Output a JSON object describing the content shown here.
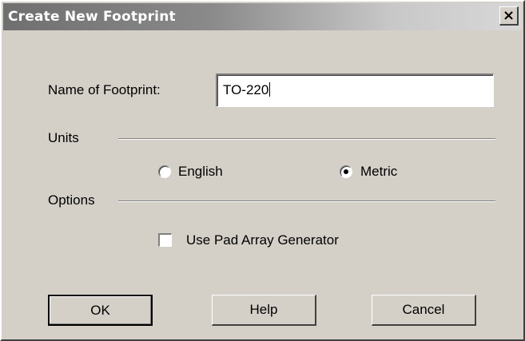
{
  "window": {
    "title": "Create New Footprint",
    "close_glyph": "×"
  },
  "name_field": {
    "label": "Name of Footprint:",
    "value": "TO-220"
  },
  "units": {
    "label": "Units",
    "options": [
      {
        "label": "English",
        "selected": false
      },
      {
        "label": "Metric",
        "selected": true
      }
    ]
  },
  "options": {
    "label": "Options",
    "pad_array": {
      "label": "Use Pad Array Generator",
      "checked": false
    }
  },
  "buttons": {
    "ok": "OK",
    "help": "Help",
    "cancel": "Cancel"
  },
  "icons": {
    "close": "close-icon",
    "radio": "radio-button",
    "checkbox": "checkbox"
  }
}
